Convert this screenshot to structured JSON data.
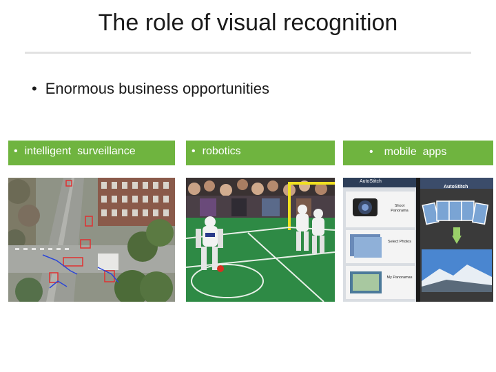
{
  "slide": {
    "title": "The role of visual recognition",
    "main_bullet": "Enormous business opportunities",
    "bullet_glyph": "•"
  },
  "panels": [
    {
      "label": "intelligent  surveillance",
      "image": "aerial-street-surveillance-photo"
    },
    {
      "label": "robotics",
      "image": "humanoid-robot-soccer-photo"
    },
    {
      "label": "mobile  apps",
      "image": "autostitch-app-screenshot"
    }
  ],
  "app_screen": {
    "header": "AutoStitch",
    "menu": [
      "Shoot Panorama",
      "Select Photos",
      "My Panoramas"
    ]
  },
  "colors": {
    "banner_green": "#6fb43f",
    "title_text": "#1a1a1a",
    "rule": "#e2e2e2"
  }
}
